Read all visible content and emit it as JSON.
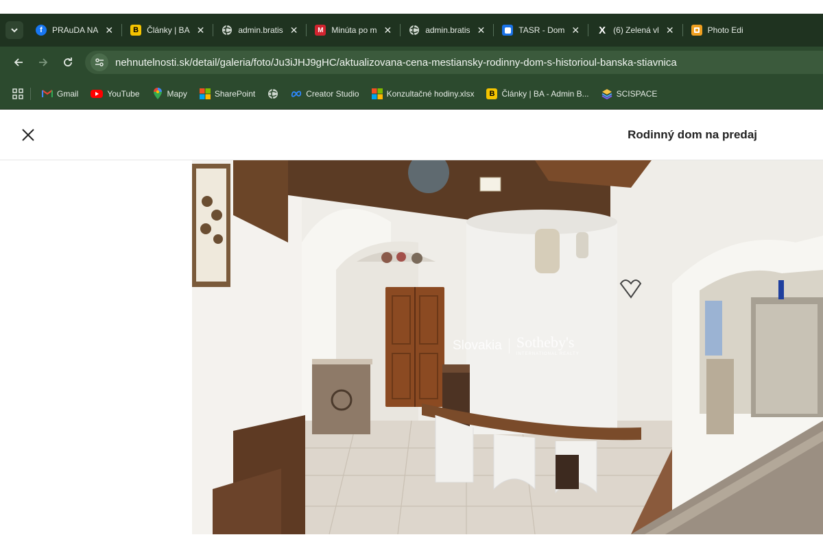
{
  "browser": {
    "tabs": [
      {
        "title": "PRAuDA NA",
        "favicon": "facebook-icon",
        "color": "#1877f2",
        "glyph": "f"
      },
      {
        "title": "Články | BA",
        "favicon": "b-logo-icon",
        "color": "#f5c400",
        "glyph": "B"
      },
      {
        "title": "admin.bratis",
        "favicon": "globe-icon",
        "color": "#cfd8cf",
        "glyph": ""
      },
      {
        "title": "Minúta po m",
        "favicon": "minuta-icon",
        "color": "#d1242f",
        "glyph": "M"
      },
      {
        "title": "admin.bratis",
        "favicon": "globe-icon",
        "color": "#cfd8cf",
        "glyph": ""
      },
      {
        "title": "TASR - Dom",
        "favicon": "tasr-icon",
        "color": "#1a73e8",
        "glyph": ""
      },
      {
        "title": "(6) Zelená vl",
        "favicon": "x-logo-icon",
        "color": "#000000",
        "glyph": "𝕏"
      },
      {
        "title": "Photo Edi",
        "favicon": "photo-editor-icon",
        "color": "#f0a020",
        "glyph": ""
      }
    ],
    "url": "nehnutelnosti.sk/detail/galeria/foto/Ju3iJHJ9gHC/aktualizovana-cena-mestiansky-rodinny-dom-s-historioul-banska-stiavnica",
    "bookmarks": [
      {
        "label": "Gmail",
        "icon": "gmail-icon"
      },
      {
        "label": "YouTube",
        "icon": "youtube-icon"
      },
      {
        "label": "Mapy",
        "icon": "maps-icon"
      },
      {
        "label": "SharePoint",
        "icon": "microsoft-icon"
      },
      {
        "label": "",
        "icon": "globe-icon"
      },
      {
        "label": "Creator Studio",
        "icon": "meta-icon"
      },
      {
        "label": "Konzultačné hodiny.xlsx",
        "icon": "microsoft-icon"
      },
      {
        "label": "Články | BA - Admin B...",
        "icon": "b-logo-icon"
      },
      {
        "label": "SCISPACE",
        "icon": "scispace-icon"
      }
    ]
  },
  "page": {
    "title": "Rodinný dom na predaj"
  },
  "photo": {
    "watermark_left": "Slovakia",
    "watermark_brand": "Sotheby's",
    "watermark_sub": "INTERNATIONAL REALTY"
  }
}
